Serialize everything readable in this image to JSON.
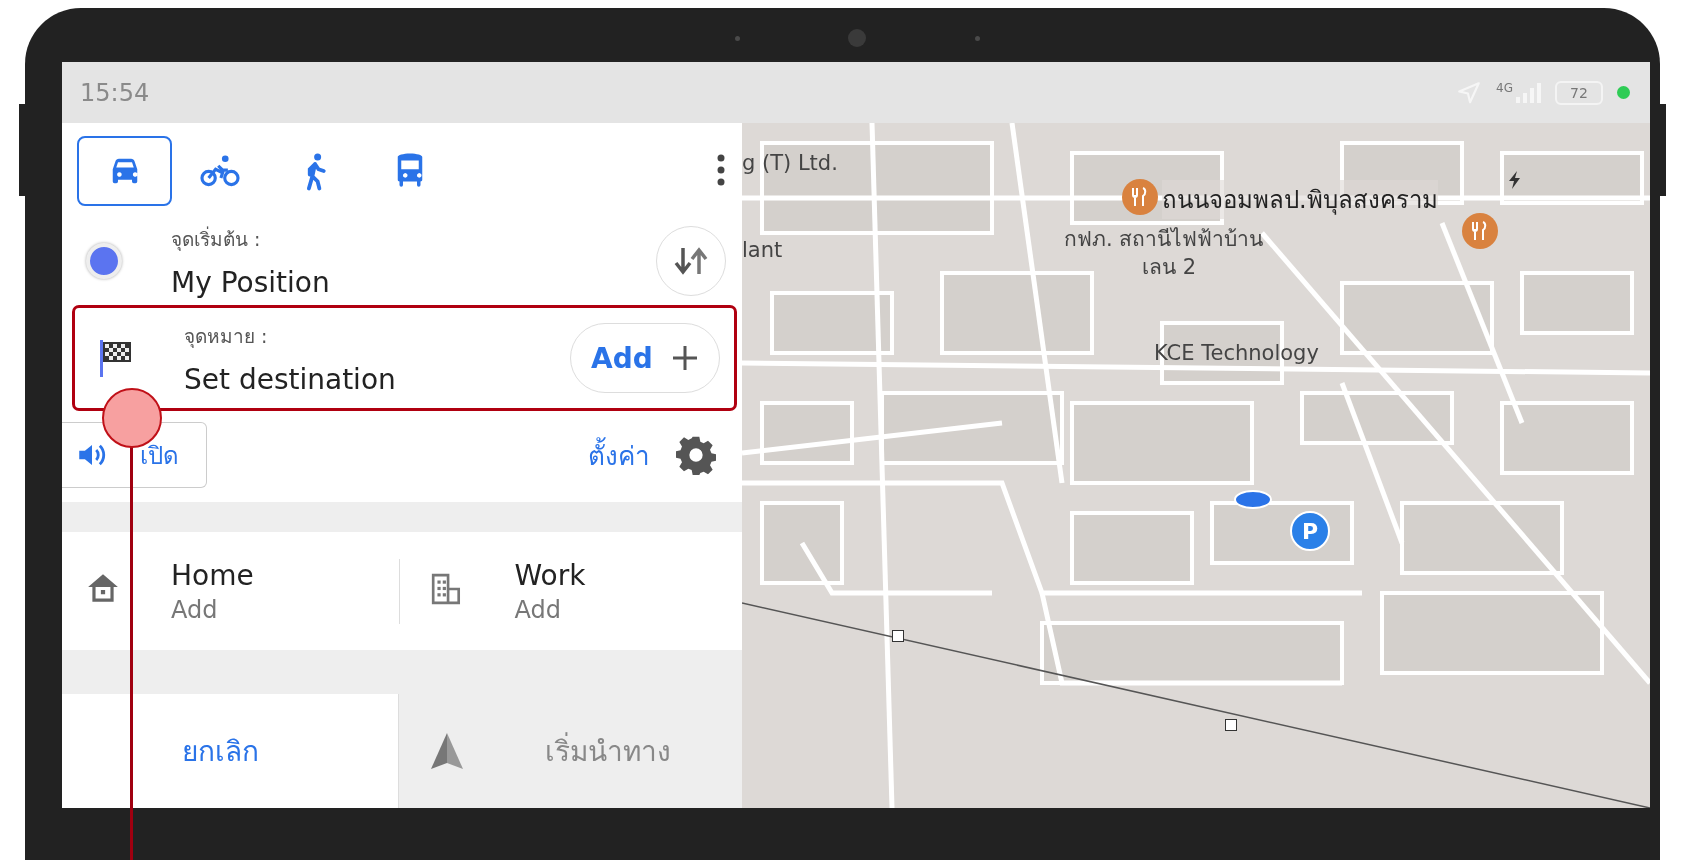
{
  "status_bar": {
    "time": "15:54",
    "network": "4G",
    "battery": "72"
  },
  "travel_modes": [
    {
      "kind": "car",
      "selected": true
    },
    {
      "kind": "bicycle",
      "selected": false
    },
    {
      "kind": "walk",
      "selected": false
    },
    {
      "kind": "bus",
      "selected": false
    }
  ],
  "start": {
    "label": "จุดเริ่มต้น :",
    "value": "My Position"
  },
  "destination": {
    "label": "จุดหมาย :",
    "value": "Set destination",
    "add_button": "Add",
    "highlighted": true
  },
  "voice_button": "เปิด",
  "settings_link": "ตั้งค่า",
  "saved_places": [
    {
      "kind": "home",
      "title": "Home",
      "subtitle": "Add"
    },
    {
      "kind": "work",
      "title": "Work",
      "subtitle": "Add"
    }
  ],
  "actions": {
    "cancel": "ยกเลิก",
    "start": "เริ่มนำทาง",
    "start_disabled": true
  },
  "map": {
    "labels": [
      {
        "kind": "place",
        "text": "g (T) Ltd."
      },
      {
        "kind": "place",
        "text": "lant"
      },
      {
        "kind": "road",
        "text": "ถนนจอมพลป.พิบุลสงคราม"
      },
      {
        "kind": "place",
        "text": "กฟภ. สถานีไฟฟ้าบ้าน"
      },
      {
        "kind": "place",
        "text": "เลน 2"
      },
      {
        "kind": "place",
        "text": "KCE Technology"
      }
    ],
    "parking_label": "P"
  }
}
